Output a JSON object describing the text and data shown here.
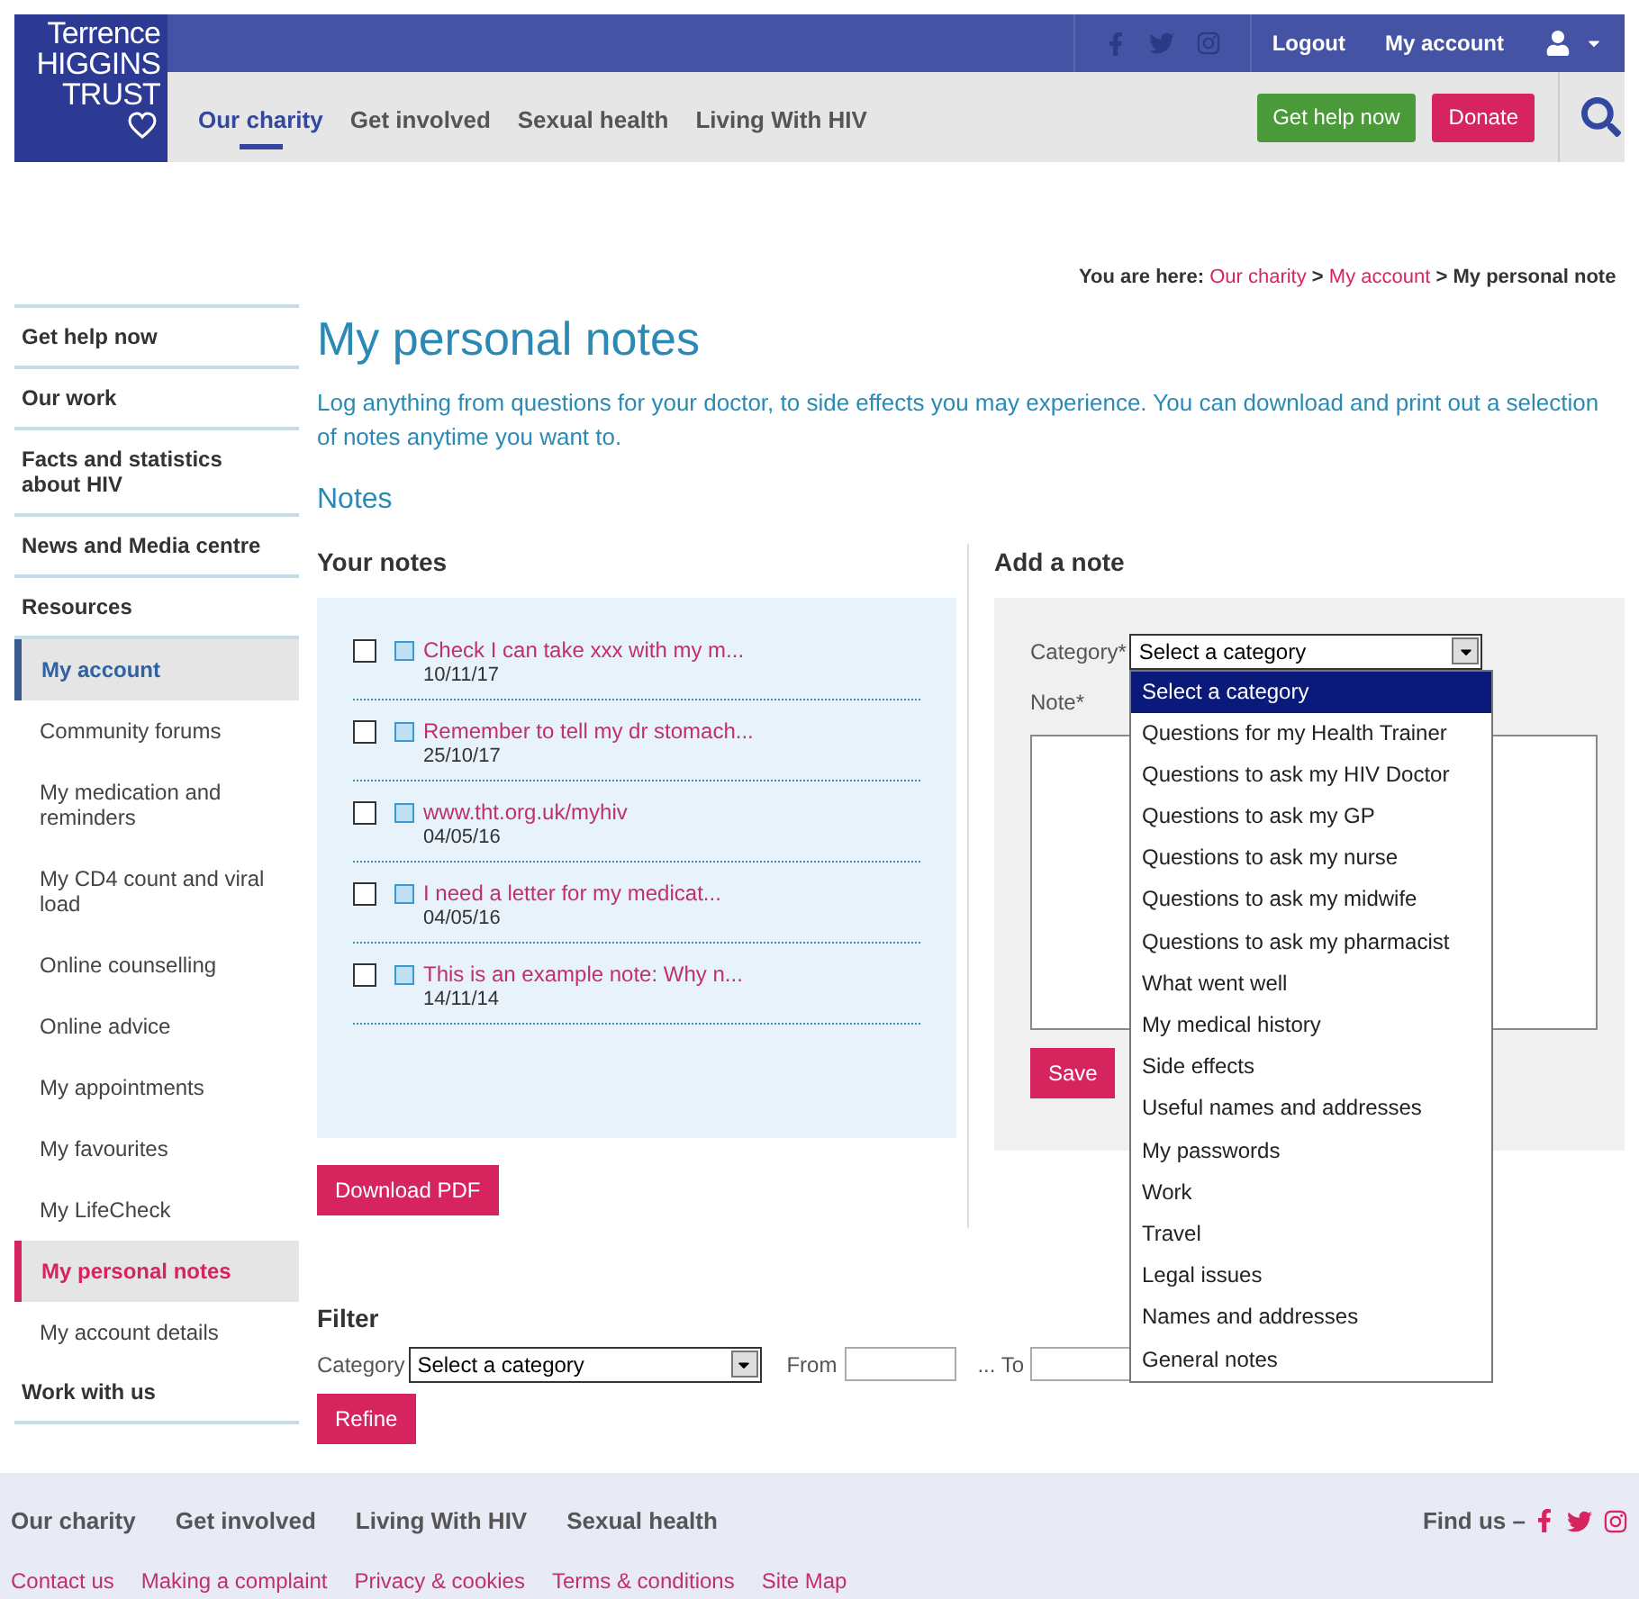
{
  "logo": {
    "lines": [
      "Terrence",
      "HIGGINS",
      "TRUST"
    ]
  },
  "top_bar": {
    "links": [
      "Logout",
      "My account"
    ]
  },
  "nav": [
    {
      "label": "Our charity",
      "selected": true
    },
    {
      "label": "Get involved",
      "selected": false
    },
    {
      "label": "Sexual health",
      "selected": false
    },
    {
      "label": "Living With HIV",
      "selected": false
    }
  ],
  "header_buttons": [
    {
      "label": "Get help now",
      "kind": "green"
    },
    {
      "label": "Donate",
      "kind": "pink"
    }
  ],
  "breadcrumb": {
    "prefix": "You are here:",
    "links": [
      "Our charity",
      "My account"
    ],
    "separator": ">",
    "current": "My personal note"
  },
  "sidebar": [
    {
      "label": "Get help now"
    },
    {
      "label": "Our work"
    },
    {
      "label": "Facts and statistics about HIV"
    },
    {
      "label": "News and Media centre"
    },
    {
      "label": "Resources"
    },
    {
      "label": "My account",
      "expanded": true,
      "children": [
        {
          "label": "Community forums",
          "selected": false
        },
        {
          "label": "My medication and reminders",
          "selected": false
        },
        {
          "label": "My CD4 count and viral load",
          "selected": false
        },
        {
          "label": "Online counselling",
          "selected": false
        },
        {
          "label": "Online advice",
          "selected": false
        },
        {
          "label": "My appointments",
          "selected": false
        },
        {
          "label": "My favourites",
          "selected": false
        },
        {
          "label": "My LifeCheck",
          "selected": false
        },
        {
          "label": "My personal notes",
          "selected": true
        },
        {
          "label": "My account details",
          "selected": false
        }
      ]
    },
    {
      "label": "Work with us"
    }
  ],
  "page": {
    "title": "My personal notes",
    "intro": "Log anything from questions for your doctor, to side effects you may experience. You can download and print out a selection of notes anytime you want to.",
    "section": "Notes"
  },
  "your_notes": {
    "heading": "Your notes",
    "notes": [
      {
        "title": "Check I can take xxx with my m...",
        "date": "10/11/17",
        "checked": false
      },
      {
        "title": "Remember to tell my dr stomach...",
        "date": "25/10/17",
        "checked": false
      },
      {
        "title": "www.tht.org.uk/myhiv",
        "date": "04/05/16",
        "checked": false
      },
      {
        "title": "I need a letter for my medicat...",
        "date": "04/05/16",
        "checked": false
      },
      {
        "title": "This is an example note: Why n...",
        "date": "14/11/14",
        "checked": false
      }
    ],
    "button": "Download PDF"
  },
  "add_note": {
    "heading": "Add a note",
    "category_label": "Category*",
    "category_value": "Select a category",
    "note_label": "Note*",
    "button": "Save",
    "dropdown": [
      {
        "label": "Select a category",
        "selected": true
      },
      {
        "label": "Questions for my Health Trainer",
        "selected": false
      },
      {
        "label": "Questions to ask my HIV Doctor",
        "selected": false
      },
      {
        "label": "Questions to ask my GP",
        "selected": false
      },
      {
        "label": "Questions to ask my nurse",
        "selected": false
      },
      {
        "label": "Questions to ask my midwife",
        "selected": false
      },
      {
        "label": "Questions to ask my pharmacist",
        "selected": false
      },
      {
        "label": "What went well",
        "selected": false
      },
      {
        "label": "My medical history",
        "selected": false
      },
      {
        "label": "Side effects",
        "selected": false
      },
      {
        "label": "Useful names and addresses",
        "selected": false
      },
      {
        "label": "My passwords",
        "selected": false
      },
      {
        "label": "Work",
        "selected": false
      },
      {
        "label": "Travel",
        "selected": false
      },
      {
        "label": "Legal issues",
        "selected": false
      },
      {
        "label": "Names and addresses",
        "selected": false
      },
      {
        "label": "General notes",
        "selected": false
      }
    ]
  },
  "filter": {
    "heading": "Filter",
    "category_label": "Category",
    "category_value": "Select a category",
    "from_label": "From",
    "to_label": "... To",
    "button": "Refine"
  },
  "footer": {
    "nav": [
      "Our charity",
      "Get involved",
      "Living With HIV",
      "Sexual health"
    ],
    "find_us": "Find us –",
    "links": [
      "Contact us",
      "Making a complaint",
      "Privacy & cookies",
      "Terms & conditions",
      "Site Map"
    ]
  }
}
